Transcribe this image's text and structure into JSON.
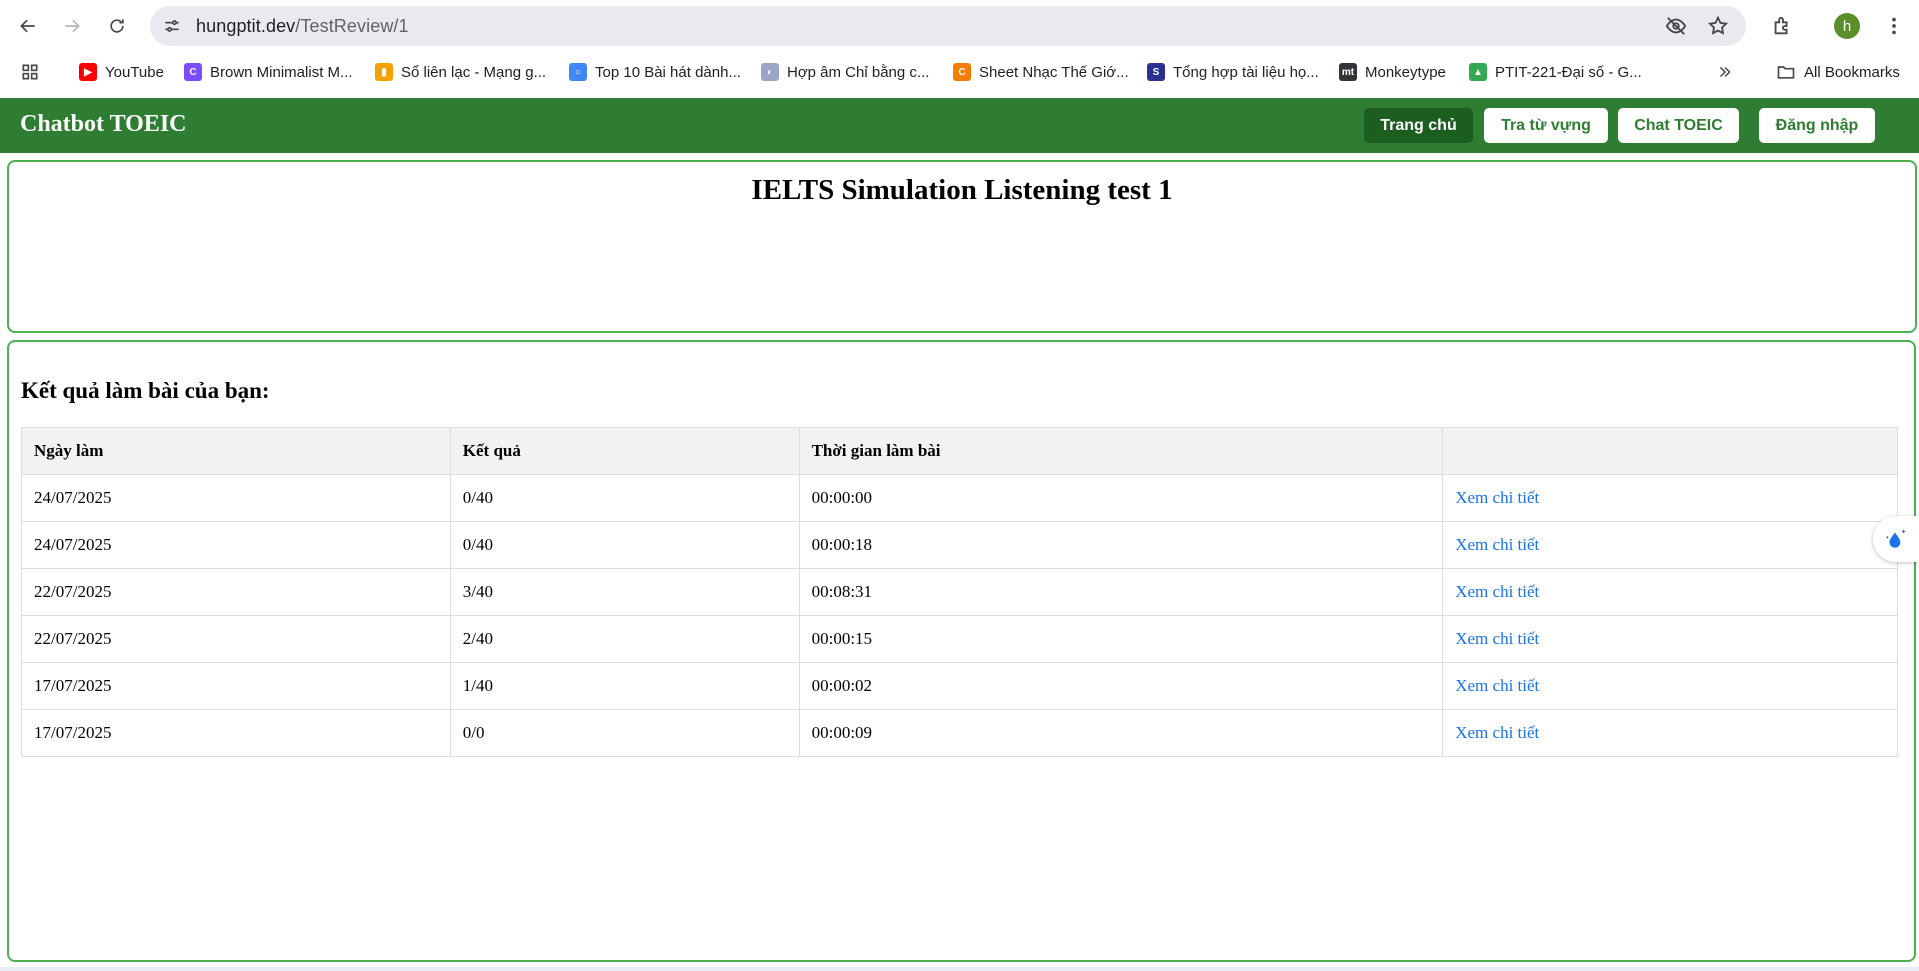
{
  "browser": {
    "url_host": "hungptit.dev",
    "url_path": "/TestReview/1",
    "avatar_letter": "h",
    "bookmarks": [
      {
        "label": "YouTube",
        "color": "#ff0000",
        "glyph": "▶"
      },
      {
        "label": "Brown Minimalist M...",
        "color": "#7b4dff",
        "glyph": "C"
      },
      {
        "label": "Sổ liên lạc - Mạng g...",
        "color": "#f4a100",
        "glyph": "▮"
      },
      {
        "label": "Top 10 Bài hát dành...",
        "color": "#4285f4",
        "glyph": "○"
      },
      {
        "label": "Hợp âm Chỉ bằng c...",
        "color": "#9aa6c9",
        "glyph": "◐"
      },
      {
        "label": "Sheet Nhạc Thế Giớ...",
        "color": "#f57c00",
        "glyph": "C"
      },
      {
        "label": "Tổng hợp tài liệu họ...",
        "color": "#2b2f8f",
        "glyph": "S"
      },
      {
        "label": "Monkeytype",
        "color": "#323437",
        "glyph": "mt"
      },
      {
        "label": "PTIT-221-Đại số - G...",
        "color": "#34a853",
        "glyph": "▲"
      }
    ],
    "all_bookmarks": "All Bookmarks"
  },
  "header": {
    "brand": "Chatbot TOEIC",
    "nav": {
      "home": "Trang chủ",
      "vocab": "Tra từ vựng",
      "chat": "Chat TOEIC",
      "login": "Đăng nhập"
    }
  },
  "test": {
    "title": "IELTS Simulation Listening test 1"
  },
  "results": {
    "heading": "Kết quả làm bài của bạn:",
    "columns": [
      "Ngày làm",
      "Kết quả",
      "Thời gian làm bài",
      ""
    ],
    "rows": [
      {
        "date": "24/07/2025",
        "score": "0/40",
        "time": "00:00:00",
        "link": "Xem chi tiết"
      },
      {
        "date": "24/07/2025",
        "score": "0/40",
        "time": "00:00:18",
        "link": "Xem chi tiết"
      },
      {
        "date": "22/07/2025",
        "score": "3/40",
        "time": "00:08:31",
        "link": "Xem chi tiết"
      },
      {
        "date": "22/07/2025",
        "score": "2/40",
        "time": "00:00:15",
        "link": "Xem chi tiết"
      },
      {
        "date": "17/07/2025",
        "score": "1/40",
        "time": "00:00:02",
        "link": "Xem chi tiết"
      },
      {
        "date": "17/07/2025",
        "score": "0/0",
        "time": "00:00:09",
        "link": "Xem chi tiết"
      }
    ]
  },
  "colors": {
    "header_green": "#2e7d32",
    "active_button": "#1b5e20",
    "panel_border": "#4caf50",
    "link_blue": "#1a73e8"
  }
}
